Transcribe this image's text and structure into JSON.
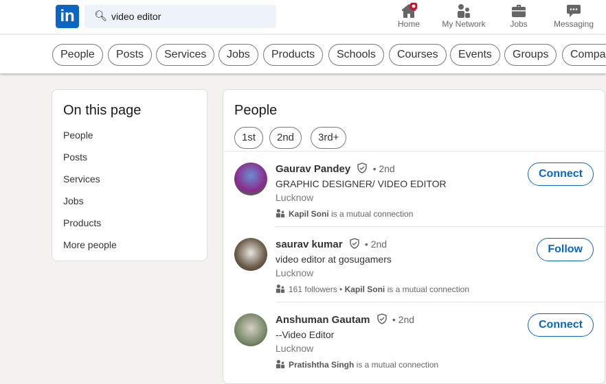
{
  "header": {
    "logo": "in",
    "search_value": "video editor",
    "nav": [
      {
        "label": "Home",
        "icon": "home-icon",
        "badge": true
      },
      {
        "label": "My Network",
        "icon": "network-icon"
      },
      {
        "label": "Jobs",
        "icon": "briefcase-icon"
      },
      {
        "label": "Messaging",
        "icon": "message-icon"
      }
    ]
  },
  "filters": [
    "People",
    "Posts",
    "Services",
    "Jobs",
    "Products",
    "Schools",
    "Courses",
    "Events",
    "Groups",
    "Companies"
  ],
  "sidebar": {
    "title": "On this page",
    "items": [
      "People",
      "Posts",
      "Services",
      "Jobs",
      "Products",
      "More people"
    ]
  },
  "people": {
    "title": "People",
    "degrees": [
      "1st",
      "2nd",
      "3rd+"
    ],
    "results": [
      {
        "name": "Gaurav Pandey",
        "degree": "• 2nd",
        "headline": "GRAPHIC DESIGNER/ VIDEO EDITOR",
        "location": "Lucknow",
        "followers": "",
        "mutual_name": "Kapil Soni",
        "mutual_text": " is a mutual connection",
        "action": "Connect"
      },
      {
        "name": "saurav kumar",
        "degree": "• 2nd",
        "headline": "video editor at gosugamers",
        "location": "Lucknow",
        "followers": "161 followers • ",
        "mutual_name": "Kapil Soni",
        "mutual_text": " is a mutual connection",
        "action": "Follow"
      },
      {
        "name": "Anshuman Gautam",
        "degree": "• 2nd",
        "headline": "--Video Editor",
        "location": "Lucknow",
        "followers": "",
        "mutual_name": "Pratishtha Singh",
        "mutual_text": " is a mutual connection",
        "action": "Connect"
      }
    ]
  },
  "colors": {
    "brand": "#0a66c2",
    "notification": "#cb112d"
  }
}
